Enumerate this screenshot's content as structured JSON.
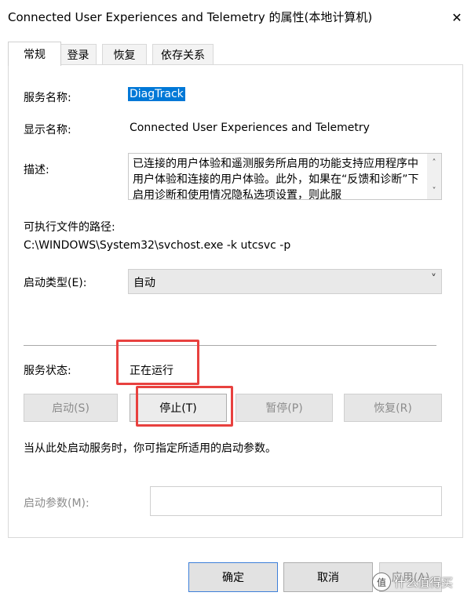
{
  "window": {
    "title": "Connected User Experiences and Telemetry 的属性(本地计算机)",
    "close_glyph": "✕"
  },
  "tabs": [
    {
      "label": "常规",
      "active": true
    },
    {
      "label": "登录"
    },
    {
      "label": "恢复"
    },
    {
      "label": "依存关系"
    }
  ],
  "general": {
    "service_name_label": "服务名称:",
    "service_name_value": "DiagTrack",
    "display_name_label": "显示名称:",
    "display_name_value": "Connected User Experiences and Telemetry",
    "description_label": "描述:",
    "description_value": "已连接的用户体验和遥测服务所启用的功能支持应用程序中用户体验和连接的用户体验。此外，如果在“反馈和诊断”下启用诊断和使用情况隐私选项设置，则此服",
    "exe_path_label": "可执行文件的路径:",
    "exe_path_value": "C:\\WINDOWS\\System32\\svchost.exe -k utcsvc -p",
    "startup_type_label": "启动类型(E):",
    "startup_type_value": "自动",
    "service_status_label": "服务状态:",
    "service_status_value": "正在运行",
    "buttons": {
      "start": "启动(S)",
      "stop": "停止(T)",
      "pause": "暂停(P)",
      "resume": "恢复(R)"
    },
    "hint": "当从此处启动服务时，你可指定所适用的启动参数。",
    "start_params_label": "启动参数(M):",
    "start_params_value": ""
  },
  "dialog_buttons": {
    "ok": "确定",
    "cancel": "取消",
    "apply": "应用(A)"
  },
  "watermark": {
    "logo_glyph": "值",
    "text": "什么值得买"
  },
  "colors": {
    "selection": "#0078d7",
    "highlight_box": "#e8413f",
    "disabled_text": "#8c8c8c",
    "ok_border": "#3d7fd9"
  }
}
